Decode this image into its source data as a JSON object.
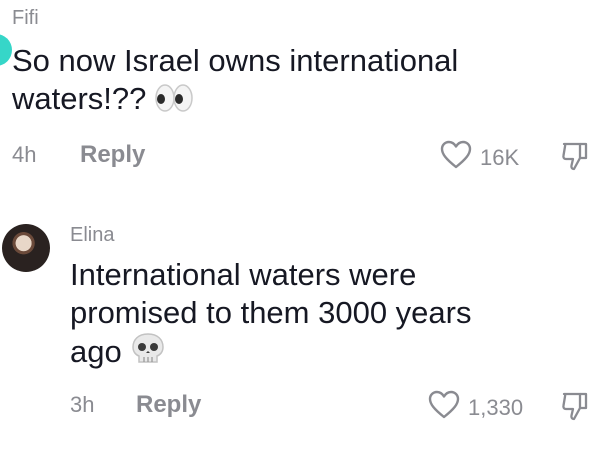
{
  "comments": [
    {
      "username": "Fifi",
      "text_line1": "So now Israel owns international",
      "text_line2": "waters!??",
      "emoji": "eyes-emoji",
      "time": "4h",
      "reply_label": "Reply",
      "likes": "16K"
    },
    {
      "username": "Elina",
      "text_line1": "International waters were",
      "text_line2": "promised to them 3000 years",
      "text_line3": "ago",
      "emoji": "skull-emoji",
      "time": "3h",
      "reply_label": "Reply",
      "likes": "1,330"
    }
  ],
  "icons": {
    "like": "heart-outline-icon",
    "dislike": "thumbs-down-outline-icon"
  },
  "colors": {
    "text": "#161823",
    "muted": "#8a8b91",
    "avatar_accent": "#36d6c8"
  }
}
